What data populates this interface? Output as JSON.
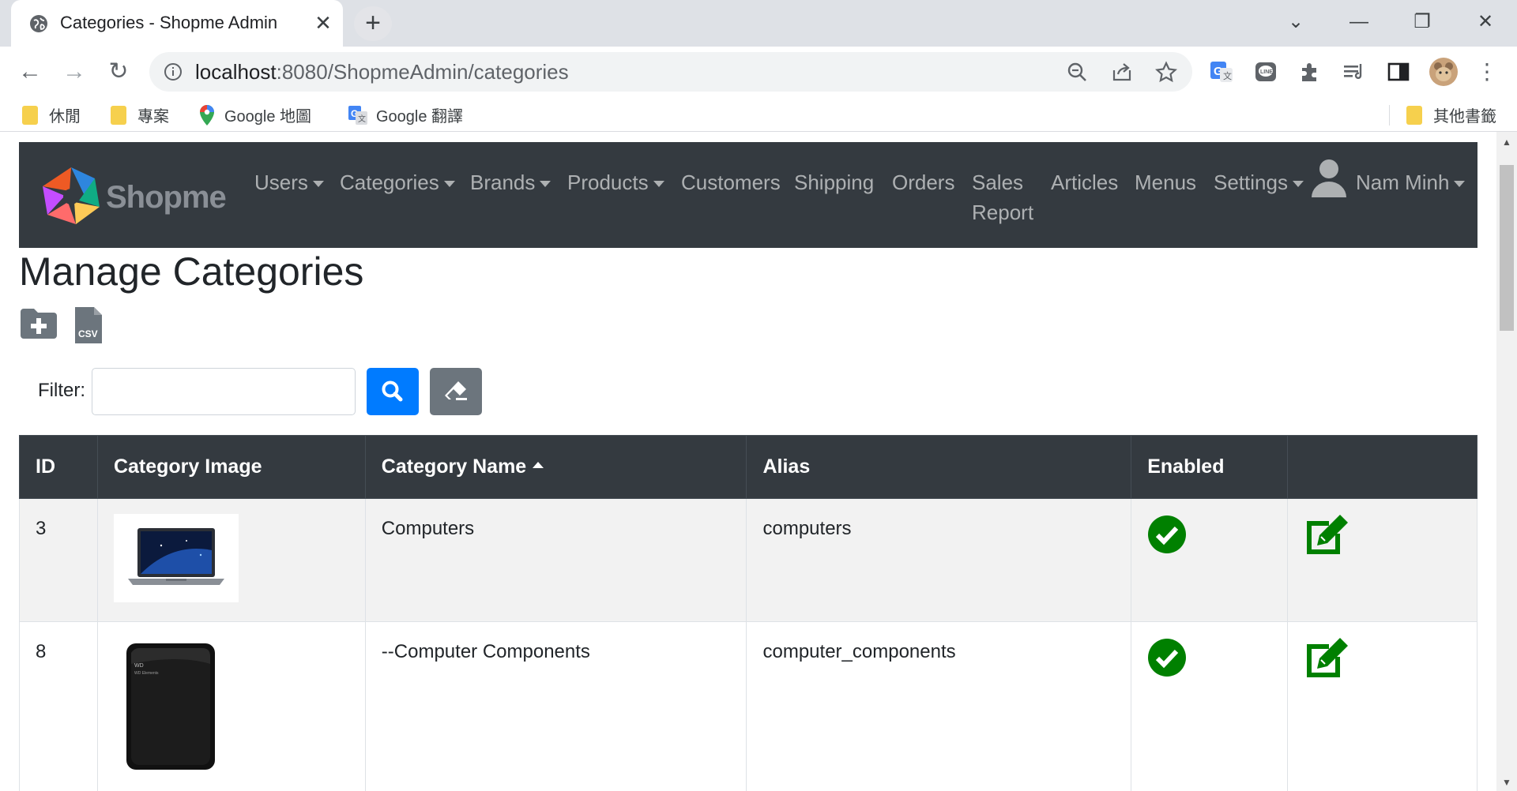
{
  "browser": {
    "tab_title": "Categories - Shopme Admin",
    "url_host": "localhost",
    "url_path": ":8080/ShopmeAdmin/categories",
    "bookmarks": [
      {
        "label": "休閒",
        "icon": "folder-icon"
      },
      {
        "label": "專案",
        "icon": "folder-icon"
      },
      {
        "label": "Google 地圖",
        "icon": "google-maps-icon"
      },
      {
        "label": "Google 翻譯",
        "icon": "google-translate-icon"
      }
    ],
    "other_bookmarks": "其他書籤"
  },
  "navbar": {
    "brand": "Shopme",
    "items": [
      {
        "label": "Users",
        "dropdown": true
      },
      {
        "label": "Categories",
        "dropdown": true
      },
      {
        "label": "Brands",
        "dropdown": true
      },
      {
        "label": "Products",
        "dropdown": true
      },
      {
        "label": "Customers",
        "dropdown": false
      },
      {
        "label": "Shipping",
        "dropdown": false
      },
      {
        "label": "Orders",
        "dropdown": false
      },
      {
        "label": "Sales",
        "dropdown": false
      },
      {
        "label": "Report",
        "dropdown": false
      },
      {
        "label": "Articles",
        "dropdown": false
      },
      {
        "label": "Menus",
        "dropdown": false
      },
      {
        "label": "Settings",
        "dropdown": true
      }
    ],
    "user_name": "Nam Minh"
  },
  "main": {
    "title": "Manage Categories",
    "filter_label": "Filter:",
    "filter_value": "",
    "actions": [
      {
        "name": "add-folder-icon"
      },
      {
        "name": "csv-file-icon"
      }
    ]
  },
  "table": {
    "headers": [
      "ID",
      "Category Image",
      "Category Name",
      "Alias",
      "Enabled",
      ""
    ],
    "sorted_by": "Category Name",
    "sort_direction": "asc",
    "rows": [
      {
        "id": "3",
        "image": "laptop",
        "name": "Computers",
        "alias": "computers",
        "enabled": true
      },
      {
        "id": "8",
        "image": "hard-drive",
        "name": "--Computer Components",
        "alias": "computer_components",
        "enabled": true
      }
    ]
  },
  "colors": {
    "navbar_bg": "#343a40",
    "primary": "#007bff",
    "secondary": "#6c757d",
    "enabled_green": "#008000"
  }
}
